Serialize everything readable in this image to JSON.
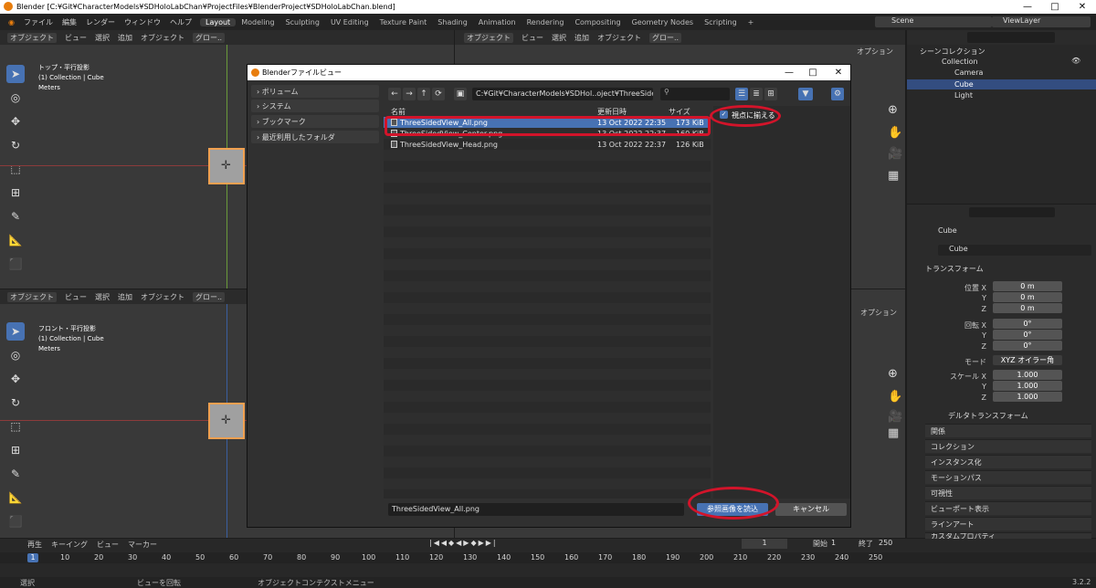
{
  "window": {
    "title": "Blender [C:¥Git¥CharacterModels¥SDHoloLabChan¥ProjectFiles¥BlenderProject¥SDHoloLabChan.blend]",
    "min": "—",
    "max": "□",
    "close": "✕"
  },
  "menu": {
    "items": [
      "ファイル",
      "編集",
      "レンダー",
      "ウィンドウ",
      "ヘルプ"
    ],
    "workspaces": [
      "Layout",
      "Modeling",
      "Sculpting",
      "UV Editing",
      "Texture Paint",
      "Shading",
      "Animation",
      "Rendering",
      "Compositing",
      "Geometry Nodes",
      "Scripting"
    ],
    "add_workspace": "+",
    "scene": "Scene",
    "view_layer": "ViewLayer"
  },
  "viewport_header": {
    "mode": "オブジェクト",
    "view": "ビュー",
    "select": "選択",
    "add": "追加",
    "object": "オブジェクト",
    "global": "グロー..",
    "options": "オプション"
  },
  "viewport_top": {
    "name": "トップ・平行投影",
    "collection": "(1) Collection | Cube",
    "units": "Meters"
  },
  "viewport_front": {
    "name": "フロント・平行投影",
    "collection": "(1) Collection | Cube",
    "units": "Meters"
  },
  "outliner": {
    "title": "シーンコレクション",
    "collection": "Collection",
    "items": [
      "Camera",
      "Cube",
      "Light"
    ]
  },
  "properties": {
    "object_name": "Cube",
    "object_field": "Cube",
    "transform": "トランスフォーム",
    "location": "位置 X",
    "rotation": "回転 X",
    "mode_label": "モード",
    "mode_value": "XYZ オイラー角",
    "scale": "スケール X",
    "y": "Y",
    "z": "Z",
    "loc_values": [
      "0 m",
      "0 m",
      "0 m"
    ],
    "rot_values": [
      "0°",
      "0°",
      "0°"
    ],
    "scale_values": [
      "1.000",
      "1.000",
      "1.000"
    ],
    "delta": "デルタトランスフォーム",
    "sections": [
      "関係",
      "コレクション",
      "インスタンス化",
      "モーションパス",
      "可視性",
      "ビューポート表示",
      "ラインアート",
      "カスタムプロパティ"
    ]
  },
  "dialog": {
    "title": "Blenderファイルビュー",
    "sidebar": [
      "ボリューム",
      "システム",
      "ブックマーク",
      "最近利用したフォルダ"
    ],
    "path": "C:¥Git¥CharacterModels¥SDHol..oject¥ThreeSidedViewPicuture¥",
    "columns": {
      "name": "名前",
      "date": "更新日時",
      "size": "サイズ"
    },
    "files": [
      {
        "name": "ThreeSidedView_All.png",
        "date": "13 Oct 2022 22:35",
        "size": "173 KiB"
      },
      {
        "name": "ThreeSidedView_Center.png",
        "date": "13 Oct 2022 22:37",
        "size": "160 KiB"
      },
      {
        "name": "ThreeSidedView_Head.png",
        "date": "13 Oct 2022 22:37",
        "size": "126 KiB"
      }
    ],
    "align_to_view": "視点に揃える",
    "filename": "ThreeSidedView_All.png",
    "ok": "参照画像を読込",
    "cancel": "キャンセル"
  },
  "timeline": {
    "playback": "再生",
    "keying": "キーイング",
    "view": "ビュー",
    "marker": "マーカー",
    "current_frame": "1",
    "start_label": "開始",
    "start": "1",
    "end_label": "終了",
    "end": "250",
    "ticks": [
      "1",
      "10",
      "20",
      "30",
      "40",
      "50",
      "60",
      "70",
      "80",
      "90",
      "100",
      "110",
      "120",
      "130",
      "140",
      "150",
      "160",
      "170",
      "180",
      "190",
      "200",
      "210",
      "220",
      "230",
      "240",
      "250"
    ]
  },
  "status": {
    "select": "選択",
    "rotate": "ビューを回転",
    "context": "オブジェクトコンテクストメニュー",
    "version": "3.2.2"
  }
}
